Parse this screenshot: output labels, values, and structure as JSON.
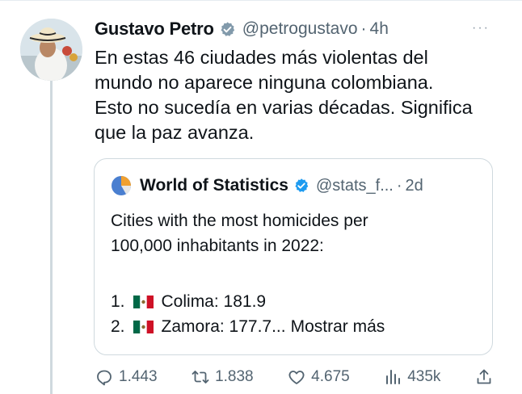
{
  "tweet": {
    "author_name": "Gustavo Petro",
    "handle": "@petrogustavo",
    "separator": "·",
    "time": "4h",
    "more_label": "···",
    "text": "En estas 46 ciudades más violentas del\nmundo no aparece ninguna colombiana.\nEsto no sucedía en varias décadas. Significa\nque la paz avanza."
  },
  "quote": {
    "author_name": "World of Statistics",
    "handle": "@stats_f...",
    "separator": "·",
    "time": "2d",
    "text": "Cities with the most homicides per\n100,000 inhabitants in 2022:",
    "items": [
      {
        "number": "1.",
        "city": "Colima: 181.9",
        "flag": "mexico-flag"
      },
      {
        "number": "2.",
        "city": "Zamora: 177.7...",
        "flag": "mexico-flag"
      }
    ],
    "show_more": "Mostrar más"
  },
  "actions": {
    "replies": "1.443",
    "retweets": "1.838",
    "likes": "4.675",
    "views": "435k"
  },
  "colors": {
    "verified": "#1d9bf0",
    "muted_text": "#536471",
    "border": "#cfd9de",
    "flag_green": "#006847",
    "flag_red": "#ce1126"
  }
}
